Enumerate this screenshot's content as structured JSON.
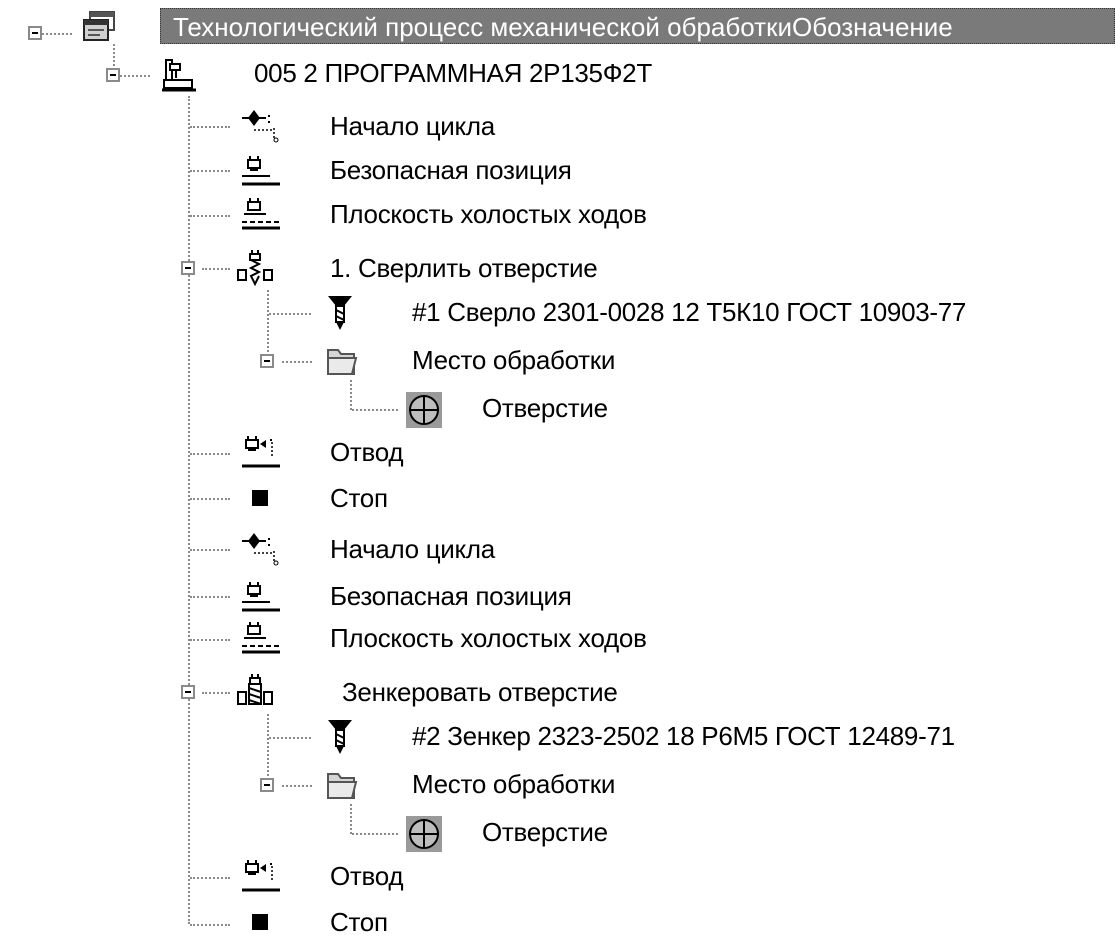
{
  "tree": {
    "root": {
      "label": "Технологический процесс механической обработкиОбозначение",
      "icon": "process-window-icon"
    },
    "operation": {
      "label": "005 2 ПРОГРАММНАЯ 2Р135Ф2Т",
      "icon": "machine-icon"
    },
    "steps": [
      {
        "label": "Начало цикла",
        "icon": "cycle-start-icon"
      },
      {
        "label": "Безопасная позиция",
        "icon": "safe-position-icon"
      },
      {
        "label": "Плоскость холостых ходов",
        "icon": "idle-plane-icon"
      },
      {
        "label": "1. Сверлить отверстие",
        "icon": "drill-operation-icon"
      },
      {
        "label": "#1 Сверло 2301-0028 12 Т5К10 ГОСТ 10903-77",
        "icon": "drill-tool-icon"
      },
      {
        "label": "Место обработки",
        "icon": "folder-icon"
      },
      {
        "label": "Отверстие",
        "icon": "hole-icon"
      },
      {
        "label": "Отвод",
        "icon": "retract-icon"
      },
      {
        "label": "Стоп",
        "icon": "stop-icon"
      },
      {
        "label": "Начало цикла",
        "icon": "cycle-start-icon"
      },
      {
        "label": "Безопасная позиция",
        "icon": "safe-position-icon"
      },
      {
        "label": "Плоскость холостых ходов",
        "icon": "idle-plane-icon"
      },
      {
        "label": "Зенкеровать отверстие",
        "icon": "countersink-operation-icon"
      },
      {
        "label": "#2 Зенкер 2323-2502 18 Р6М5 ГОСТ 12489-71",
        "icon": "countersink-tool-icon"
      },
      {
        "label": "Место обработки",
        "icon": "folder-icon"
      },
      {
        "label": "Отверстие",
        "icon": "hole-icon"
      },
      {
        "label": "Отвод",
        "icon": "retract-icon"
      },
      {
        "label": "Стоп",
        "icon": "stop-icon"
      }
    ]
  },
  "colors": {
    "selection_bg": "#7a7a7a",
    "selection_text": "#ffffff",
    "tree_lines": "#8a8a8a"
  }
}
